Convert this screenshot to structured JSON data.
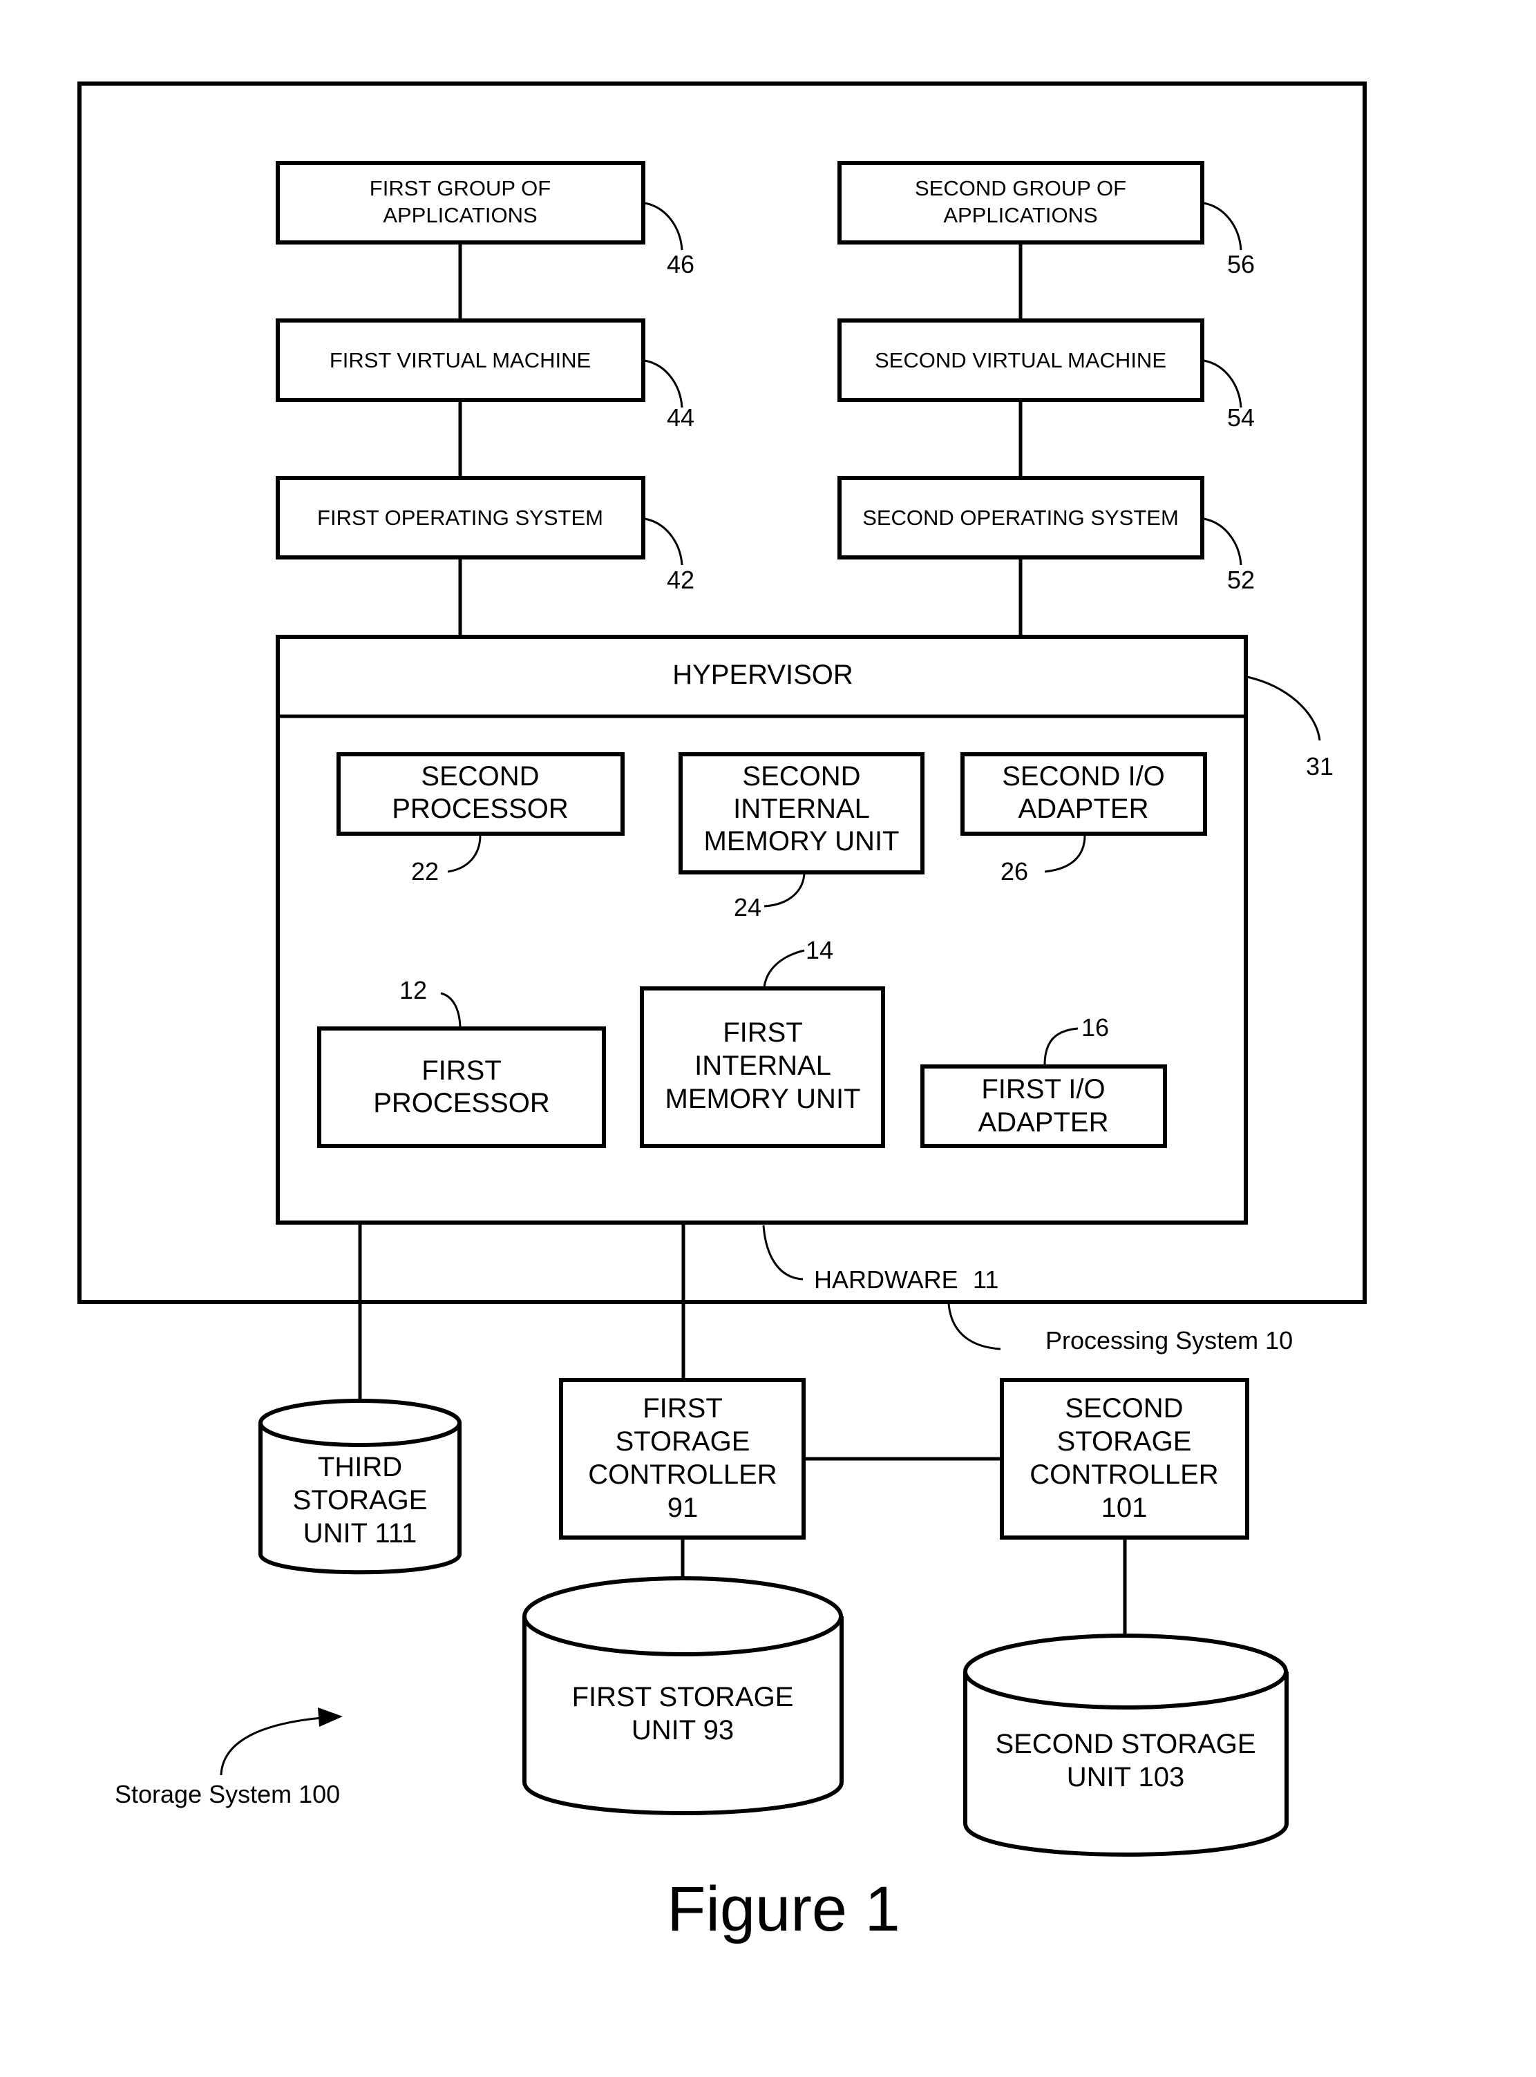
{
  "figure": {
    "title": "Figure 1",
    "storage_system_label": "Storage System 100",
    "processing_system_label": "Processing System 10",
    "hardware_label": "HARDWARE",
    "hardware_ref": "11"
  },
  "software_stack": {
    "left": [
      {
        "lines": [
          "FIRST GROUP OF",
          "APPLICATIONS"
        ],
        "ref": "46"
      },
      {
        "lines": [
          "FIRST VIRTUAL MACHINE"
        ],
        "ref": "44"
      },
      {
        "lines": [
          "FIRST OPERATING SYSTEM"
        ],
        "ref": "42"
      }
    ],
    "right": [
      {
        "lines": [
          "SECOND GROUP OF",
          "APPLICATIONS"
        ],
        "ref": "56"
      },
      {
        "lines": [
          "SECOND VIRTUAL MACHINE"
        ],
        "ref": "54"
      },
      {
        "lines": [
          "SECOND OPERATING SYSTEM"
        ],
        "ref": "52"
      }
    ]
  },
  "hypervisor": {
    "label": "HYPERVISOR",
    "ref": "31"
  },
  "hardware_components": {
    "second_processor": {
      "lines": [
        "SECOND",
        "PROCESSOR"
      ],
      "ref": "22"
    },
    "second_memory": {
      "lines": [
        "SECOND",
        "INTERNAL",
        "MEMORY UNIT"
      ],
      "ref": "24"
    },
    "second_io": {
      "lines": [
        "SECOND I/O",
        "ADAPTER"
      ],
      "ref": "26"
    },
    "first_processor": {
      "lines": [
        "FIRST",
        "PROCESSOR"
      ],
      "ref": "12"
    },
    "first_memory": {
      "lines": [
        "FIRST",
        "INTERNAL",
        "MEMORY UNIT"
      ],
      "ref": "14"
    },
    "first_io": {
      "lines": [
        "FIRST I/O",
        "ADAPTER"
      ],
      "ref": "16"
    }
  },
  "storage": {
    "third_storage_unit": {
      "lines": [
        "THIRD",
        "STORAGE",
        "UNIT 111"
      ]
    },
    "first_storage_controller": {
      "lines": [
        "FIRST",
        "STORAGE",
        "CONTROLLER",
        "91"
      ]
    },
    "second_storage_controller": {
      "lines": [
        "SECOND",
        "STORAGE",
        "CONTROLLER",
        "101"
      ]
    },
    "first_storage_unit": {
      "lines": [
        "FIRST STORAGE",
        "UNIT 93"
      ]
    },
    "second_storage_unit": {
      "lines": [
        "SECOND STORAGE",
        "UNIT 103"
      ]
    }
  }
}
